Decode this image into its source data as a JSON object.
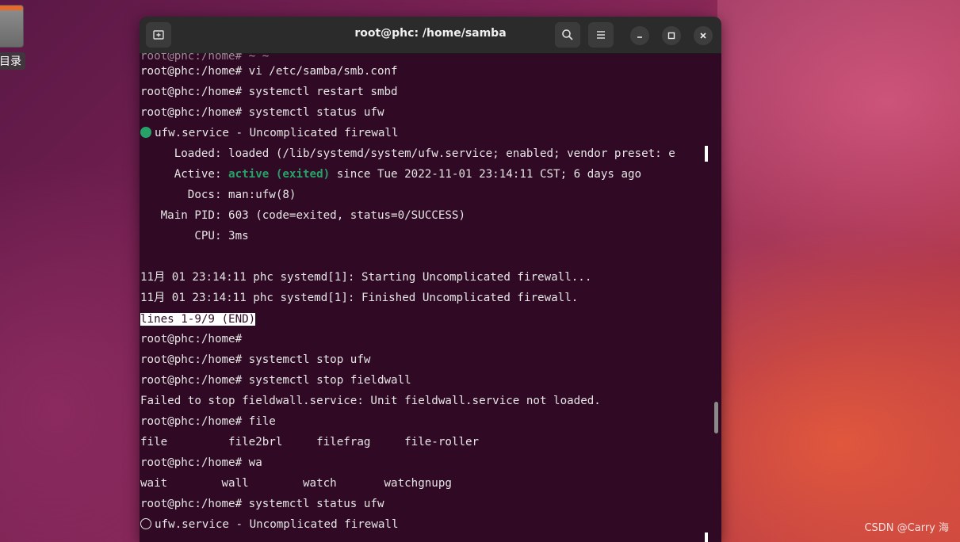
{
  "desktop": {
    "icon_label": "目录"
  },
  "window": {
    "title": "root@phc: /home/samba"
  },
  "terminal": {
    "lines": [
      "root@phc:/home# vi /etc/samba/smb.conf",
      "root@phc:/home# systemctl restart smbd",
      "root@phc:/home# systemctl status ufw",
      "ufw.service - Uncomplicated firewall",
      "     Loaded: loaded (/lib/systemd/system/ufw.service; enabled; vendor preset: e",
      "     Active: ",
      "active (exited)",
      " since Tue 2022-11-01 23:14:11 CST; 6 days ago",
      "       Docs: man:ufw(8)",
      "   Main PID: 603 (code=exited, status=0/SUCCESS)",
      "        CPU: 3ms",
      "11月 01 23:14:11 phc systemd[1]: Starting Uncomplicated firewall...",
      "11月 01 23:14:11 phc systemd[1]: Finished Uncomplicated firewall.",
      "lines 1-9/9 (END)",
      "root@phc:/home#",
      "root@phc:/home# systemctl stop ufw",
      "root@phc:/home# systemctl stop fieldwall",
      "Failed to stop fieldwall.service: Unit fieldwall.service not loaded.",
      "root@phc:/home# file",
      "file         file2brl     filefrag     file-roller",
      "root@phc:/home# wa",
      "wait        wall        watch       watchgnupg",
      "root@phc:/home# systemctl status ufw",
      "ufw.service - Uncomplicated firewall"
    ]
  },
  "watermark": "CSDN @Carry 海",
  "colors": {
    "terminal_bg": "#300a24",
    "active_green": "#26a269",
    "titlebar": "#2b2b2b"
  },
  "icons": [
    "new-tab-icon",
    "search-icon",
    "menu-icon",
    "minimize-icon",
    "maximize-icon",
    "close-icon"
  ]
}
